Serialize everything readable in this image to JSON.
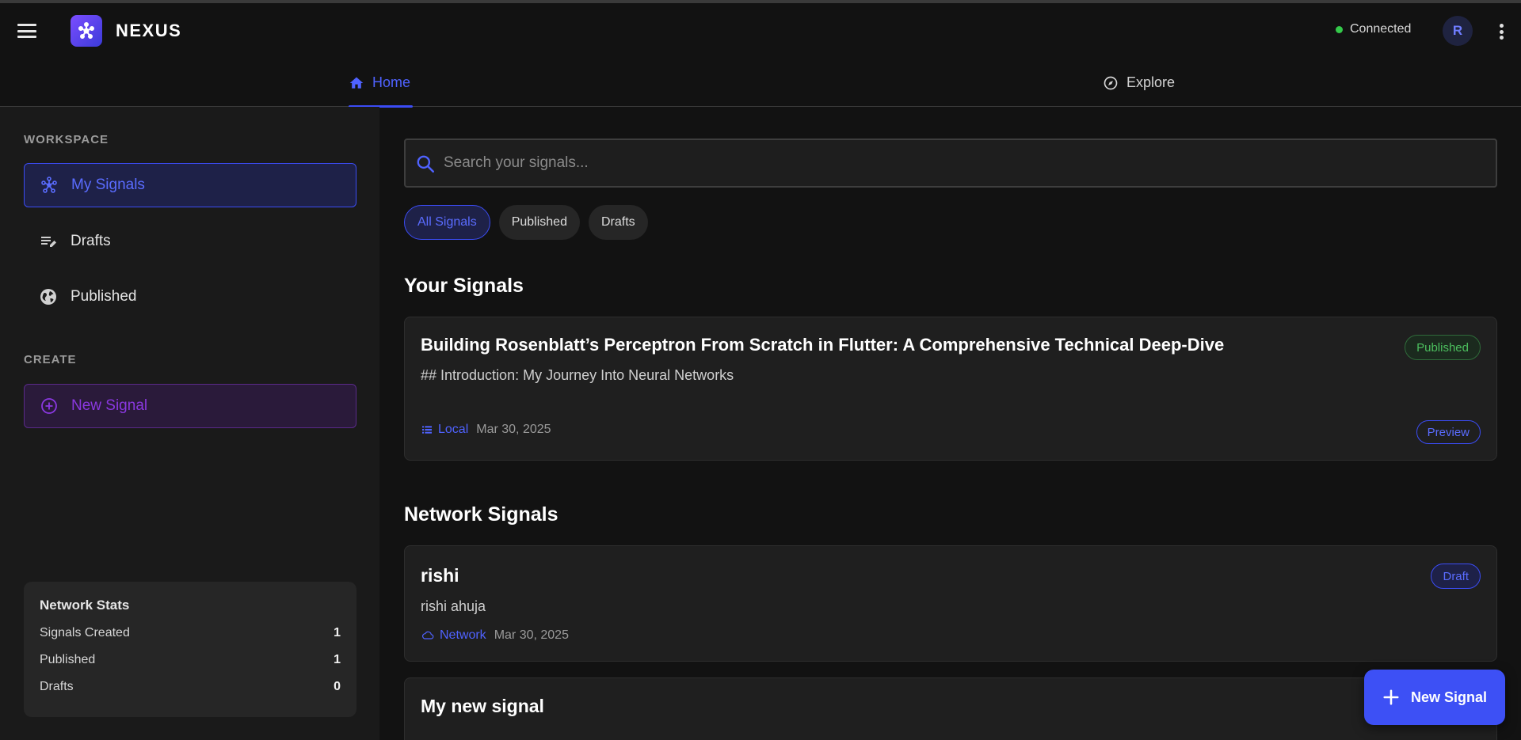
{
  "app": {
    "brand": "NEXUS",
    "status": "Connected",
    "avatar_initial": "R"
  },
  "tabs": [
    {
      "label": "Home",
      "icon": "home-icon",
      "active": true
    },
    {
      "label": "Explore",
      "icon": "compass-icon",
      "active": false
    }
  ],
  "sidebar": {
    "workspace_label": "WORKSPACE",
    "items": [
      {
        "label": "My Signals",
        "icon": "network-icon",
        "active": true
      },
      {
        "label": "Drafts",
        "icon": "edit-list-icon",
        "active": false
      },
      {
        "label": "Published",
        "icon": "globe-icon",
        "active": false
      }
    ],
    "create_label": "CREATE",
    "create_item": {
      "label": "New Signal",
      "icon": "add-circle-icon"
    },
    "stats": {
      "title": "Network Stats",
      "rows": [
        {
          "label": "Signals Created",
          "value": "1"
        },
        {
          "label": "Published",
          "value": "1"
        },
        {
          "label": "Drafts",
          "value": "0"
        }
      ]
    }
  },
  "search": {
    "placeholder": "Search your signals..."
  },
  "filters": [
    {
      "label": "All Signals",
      "active": true
    },
    {
      "label": "Published",
      "active": false
    },
    {
      "label": "Drafts",
      "active": false
    }
  ],
  "your_signals": {
    "heading": "Your Signals",
    "cards": [
      {
        "title": "Building Rosenblatt’s Perceptron From Scratch in Flutter: A Comprehensive Technical Deep-Dive",
        "subtitle": "## Introduction: My Journey Into Neural Networks",
        "source": "Local",
        "date": "Mar 30, 2025",
        "badge": "Published",
        "action": "Preview"
      }
    ]
  },
  "network_signals": {
    "heading": "Network Signals",
    "cards": [
      {
        "title": "rishi",
        "subtitle": "rishi ahuja",
        "source": "Network",
        "date": "Mar 30, 2025",
        "badge": "Draft"
      },
      {
        "title": "My new signal"
      }
    ]
  },
  "fab": {
    "label": "New Signal"
  },
  "colors": {
    "accent": "#3b4cf5",
    "background": "#121212",
    "sidebar": "#1a1a1a",
    "published": "#4cbf5e",
    "create": "#8a38e0"
  }
}
